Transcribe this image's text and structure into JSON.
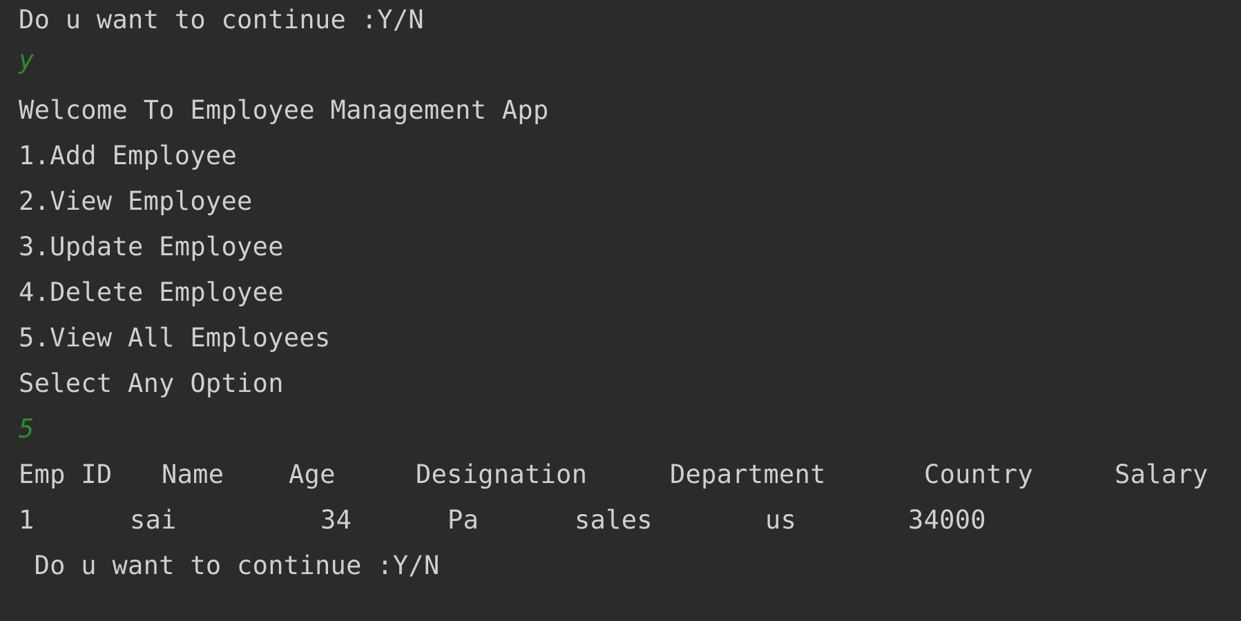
{
  "colors": {
    "background": "#2b2b2b",
    "output_text": "#d0d0d0",
    "user_input": "#2e8b2e"
  },
  "console": {
    "prompt_continue": "Do u want to continue :Y/N",
    "input_continue": "y",
    "welcome": "Welcome To Employee Management App",
    "menu": [
      "1.Add Employee",
      "2.View Employee",
      "3.Update Employee",
      "4.Delete Employee",
      "5.View All Employees"
    ],
    "select_prompt": "Select Any Option",
    "input_option": "5",
    "table": {
      "headers": [
        "Emp ID",
        "Name",
        "Age",
        "Designation",
        "Department",
        "Country",
        "Salary"
      ],
      "rows": [
        [
          "1",
          "sai",
          "34",
          "Pa",
          "sales",
          "us",
          "34000"
        ]
      ]
    },
    "prompt_continue_2": " Do u want to continue :Y/N"
  }
}
